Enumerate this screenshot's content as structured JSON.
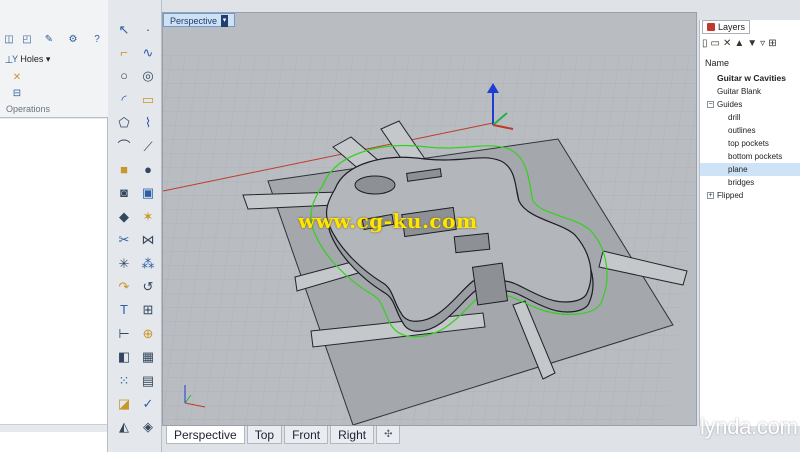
{
  "left_panel": {
    "holes_label": "Holes",
    "section_label": "Operations"
  },
  "toolbar": {
    "tools": [
      {
        "name": "select-arrow-icon",
        "glyph": "↖"
      },
      {
        "name": "point-icon",
        "glyph": "·"
      },
      {
        "name": "polyline-icon",
        "glyph": "⌐"
      },
      {
        "name": "curve-points-icon",
        "glyph": "∿"
      },
      {
        "name": "circle-icon",
        "glyph": "○"
      },
      {
        "name": "ellipse-icon",
        "glyph": "◎"
      },
      {
        "name": "arc-icon",
        "glyph": "◜"
      },
      {
        "name": "rectangle-icon",
        "glyph": "▭"
      },
      {
        "name": "polygon-icon",
        "glyph": "⬠"
      },
      {
        "name": "free-curve-icon",
        "glyph": "⌇"
      },
      {
        "name": "fillet-icon",
        "glyph": "⌒"
      },
      {
        "name": "offset-icon",
        "glyph": "⟋"
      },
      {
        "name": "box-solid-icon",
        "glyph": "■"
      },
      {
        "name": "sphere-icon",
        "glyph": "●"
      },
      {
        "name": "cylinder-icon",
        "glyph": "◙"
      },
      {
        "name": "extrude-icon",
        "glyph": "▣"
      },
      {
        "name": "boolean-icon",
        "glyph": "◆"
      },
      {
        "name": "split-icon",
        "glyph": "✶"
      },
      {
        "name": "trim-icon",
        "glyph": "✂"
      },
      {
        "name": "join-icon",
        "glyph": "⋈"
      },
      {
        "name": "explode-icon",
        "glyph": "✳"
      },
      {
        "name": "group-icon",
        "glyph": "⁂"
      },
      {
        "name": "move-icon",
        "glyph": "↷"
      },
      {
        "name": "copy-icon",
        "glyph": "↺"
      },
      {
        "name": "text-tool-icon",
        "glyph": "T"
      },
      {
        "name": "array-icon",
        "glyph": "⊞"
      },
      {
        "name": "dimension-icon",
        "glyph": "⊢"
      },
      {
        "name": "gumball-icon",
        "glyph": "⊕"
      },
      {
        "name": "solid-edit-icon",
        "glyph": "◧"
      },
      {
        "name": "mesh-icon",
        "glyph": "▦"
      },
      {
        "name": "grid-array-icon",
        "glyph": "⁙"
      },
      {
        "name": "layer-icon",
        "glyph": "▤"
      },
      {
        "name": "render-icon",
        "glyph": "◪"
      },
      {
        "name": "check-icon",
        "glyph": "✓"
      },
      {
        "name": "analyze-icon",
        "glyph": "◭"
      },
      {
        "name": "paint-icon",
        "glyph": "◈"
      }
    ]
  },
  "viewport": {
    "title": "Perspective",
    "watermark": "www.cg-ku.com",
    "tabs": [
      "Perspective",
      "Top",
      "Front",
      "Right",
      "✣"
    ],
    "active_tab": "Perspective"
  },
  "layers": {
    "panel_title": "Layers",
    "column_header": "Name",
    "items": [
      {
        "label": "Guitar w Cavities",
        "indent": 1,
        "bold": true,
        "selected": false,
        "expander": ""
      },
      {
        "label": "Guitar Blank",
        "indent": 1,
        "bold": false,
        "selected": false,
        "expander": ""
      },
      {
        "label": "Guides",
        "indent": 1,
        "bold": false,
        "selected": false,
        "expander": "−"
      },
      {
        "label": "drill",
        "indent": 2,
        "bold": false,
        "selected": false,
        "expander": ""
      },
      {
        "label": "outlines",
        "indent": 2,
        "bold": false,
        "selected": false,
        "expander": ""
      },
      {
        "label": "top pockets",
        "indent": 2,
        "bold": false,
        "selected": false,
        "expander": ""
      },
      {
        "label": "bottom pockets",
        "indent": 2,
        "bold": false,
        "selected": false,
        "expander": ""
      },
      {
        "label": "plane",
        "indent": 2,
        "bold": false,
        "selected": true,
        "expander": ""
      },
      {
        "label": "bridges",
        "indent": 2,
        "bold": false,
        "selected": false,
        "expander": ""
      },
      {
        "label": "Flipped",
        "indent": 1,
        "bold": false,
        "selected": false,
        "expander": "+"
      }
    ]
  },
  "branding": {
    "logo": "lynda.com"
  },
  "colors": {
    "viewport_bg": "#b9bdc2",
    "outline_green": "#33d11c",
    "axis_red": "#c0392b",
    "axis_blue": "#1f3bd1",
    "axis_green": "#1fb34a",
    "selection": "#cfe3f8"
  }
}
